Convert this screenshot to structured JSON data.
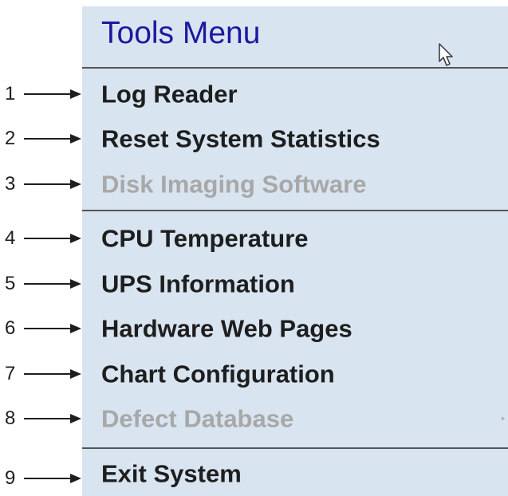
{
  "menu": {
    "title": "Tools Menu",
    "items": [
      {
        "label": "Log Reader",
        "enabled": true
      },
      {
        "label": "Reset System Statistics",
        "enabled": true
      },
      {
        "label": "Disk Imaging Software",
        "enabled": false
      },
      {
        "label": "CPU Temperature",
        "enabled": true
      },
      {
        "label": "UPS Information",
        "enabled": true
      },
      {
        "label": "Hardware Web Pages",
        "enabled": true
      },
      {
        "label": "Chart Configuration",
        "enabled": true
      },
      {
        "label": "Defect Database",
        "enabled": false,
        "has_submenu": true
      },
      {
        "label": "Exit System",
        "enabled": true
      }
    ]
  },
  "callouts": [
    "1",
    "2",
    "3",
    "4",
    "5",
    "6",
    "7",
    "8",
    "9"
  ],
  "colors": {
    "menu_background": "#d8e4f0",
    "title_text": "#1a1a9e",
    "item_text": "#1e1e1e",
    "disabled_text": "#a8a8a8",
    "separator": "#555555"
  },
  "icons": {
    "cursor": "mouse-pointer-icon",
    "submenu": "submenu-arrow-icon",
    "callout": "arrow-right-icon"
  }
}
